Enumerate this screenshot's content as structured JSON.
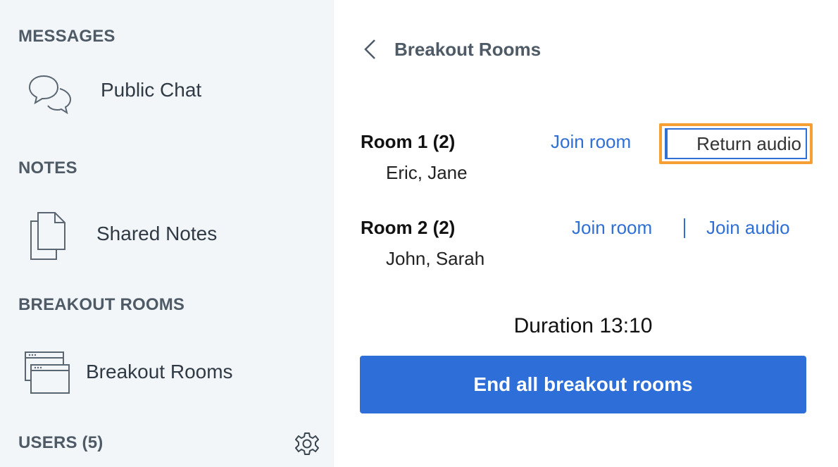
{
  "sidebar": {
    "messages_title": "MESSAGES",
    "public_chat_label": "Public Chat",
    "notes_title": "NOTES",
    "shared_notes_label": "Shared Notes",
    "breakout_title": "BREAKOUT ROOMS",
    "breakout_label": "Breakout Rooms",
    "users_title": "USERS (5)"
  },
  "main": {
    "panel_title": "Breakout Rooms",
    "rooms": [
      {
        "name": "Room 1 (2)",
        "users": "Eric, Jane",
        "join_room": "Join room",
        "audio_action": "Return audio"
      },
      {
        "name": "Room 2 (2)",
        "users": "John, Sarah",
        "join_room": "Join room",
        "audio_action": "Join audio"
      }
    ],
    "duration": "Duration 13:10",
    "end_button": "End all breakout rooms"
  },
  "colors": {
    "accent": "#2e6ed9",
    "highlight": "#f5a031",
    "sidebar_bg": "#f3f6f9"
  },
  "icons": [
    "chat-bubbles-icon",
    "notes-icon",
    "breakout-windows-icon",
    "gear-icon",
    "chevron-left-icon"
  ]
}
